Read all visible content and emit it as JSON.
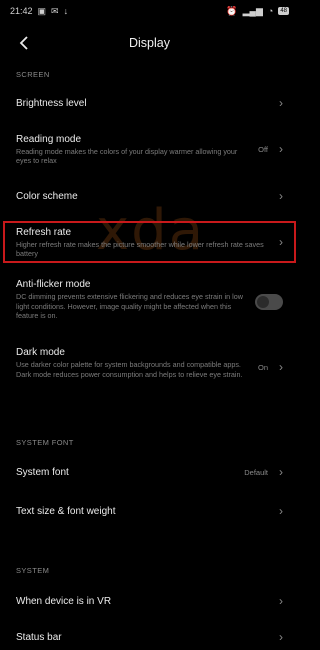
{
  "status": {
    "time": "21:42",
    "battery": "48"
  },
  "header": {
    "title": "Display",
    "back_icon": "back-arrow-icon"
  },
  "sections": {
    "screen": "SCREEN",
    "system_font": "SYSTEM FONT",
    "system": "SYSTEM"
  },
  "rows": {
    "brightness": {
      "title": "Brightness level"
    },
    "reading": {
      "title": "Reading mode",
      "subtitle": "Reading mode makes the colors of your display warmer allowing your eyes to relax",
      "value": "Off"
    },
    "color_scheme": {
      "title": "Color scheme"
    },
    "refresh_rate": {
      "title": "Refresh rate",
      "subtitle": "Higher refresh rate makes the picture smoother while lower refresh rate saves battery"
    },
    "anti_flicker": {
      "title": "Anti-flicker mode",
      "subtitle": "DC dimming prevents extensive flickering and reduces eye strain in low light conditions. However, image quality might be affected when this feature is on.",
      "enabled": false
    },
    "dark_mode": {
      "title": "Dark mode",
      "subtitle": "Use darker color palette for system backgrounds and compatible apps. Dark mode reduces power consumption and helps to relieve eye strain.",
      "value": "On"
    },
    "system_font": {
      "title": "System font",
      "value": "Default"
    },
    "text_size": {
      "title": "Text size & font weight"
    },
    "vr": {
      "title": "When device is in VR"
    },
    "status_bar": {
      "title": "Status bar"
    }
  },
  "watermark": "xda",
  "colors": {
    "background": "#000000",
    "highlight_border": "#c8191b",
    "watermark": "#aa5514"
  }
}
